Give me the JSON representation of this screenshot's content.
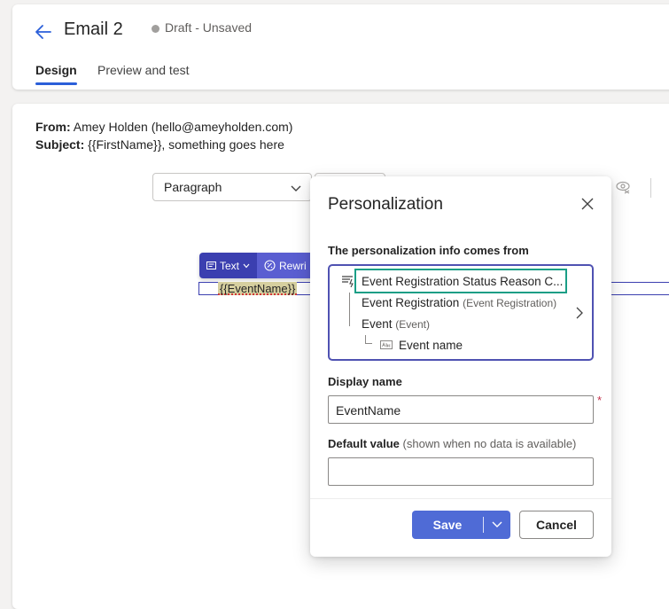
{
  "header": {
    "title": "Email 2",
    "status": "Draft - Unsaved",
    "tabs": [
      {
        "label": "Design",
        "active": true
      },
      {
        "label": "Preview and test",
        "active": false
      }
    ]
  },
  "email": {
    "from_label": "From:",
    "from_value": "Amey Holden (hello@ameyholden.com)",
    "subject_label": "Subject:",
    "subject_value": "{{FirstName}}, something goes here"
  },
  "editor": {
    "format_select": "Paragraph",
    "mini_toolbar": {
      "text_label": "Text",
      "rewrite_label": "Rewri"
    },
    "token": "{{EventName}}"
  },
  "dialog": {
    "title": "Personalization",
    "source_label": "The personalization info comes from",
    "source_items": [
      {
        "label": "Event Registration Status Reason C...",
        "sub": ""
      },
      {
        "label": "Event Registration",
        "sub": "(Event Registration)"
      },
      {
        "label": "Event",
        "sub": "(Event)"
      },
      {
        "label": "Event name",
        "sub": ""
      }
    ],
    "display_name_label": "Display name",
    "display_name_value": "EventName",
    "required_mark": "*",
    "default_value_label": "Default value",
    "default_value_hint": "(shown when no data is available)",
    "default_value_value": "",
    "save_label": "Save",
    "cancel_label": "Cancel"
  },
  "colors": {
    "accent": "#4f6bd6",
    "source_border": "#4f52b2",
    "highlight": "#1a9e86",
    "toolbar_dark": "#3b3fb0",
    "toolbar_light": "#5a5ed1"
  }
}
